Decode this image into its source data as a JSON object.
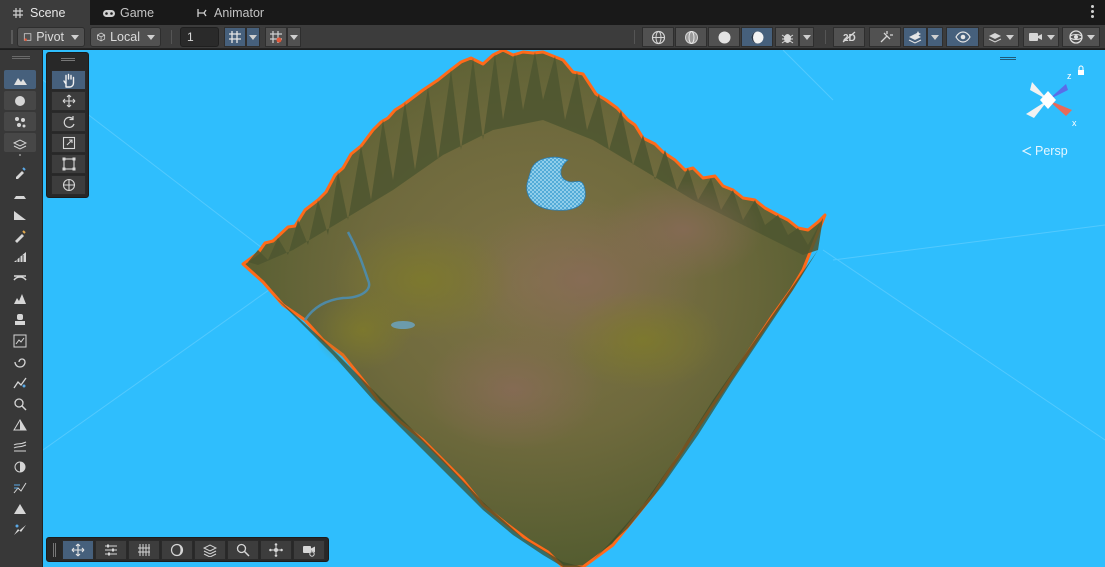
{
  "tabs": [
    {
      "label": "Scene",
      "icon": "grid-icon",
      "active": true
    },
    {
      "label": "Game",
      "icon": "gamepad-icon",
      "active": false
    },
    {
      "label": "Animator",
      "icon": "animator-icon",
      "active": false
    }
  ],
  "toolbar": {
    "pivot_label": "Pivot",
    "local_label": "Local",
    "grid_value": "1"
  },
  "scene": {
    "view_mode": "Persp",
    "background_color": "#2fbefd",
    "selection_outline_color": "#ff6a1a"
  },
  "gizmo_axes": {
    "x": "x",
    "z": "z"
  },
  "colors": {
    "accent": "#46607c",
    "toolbar": "#3c3c3c",
    "tabbar": "#191919"
  }
}
